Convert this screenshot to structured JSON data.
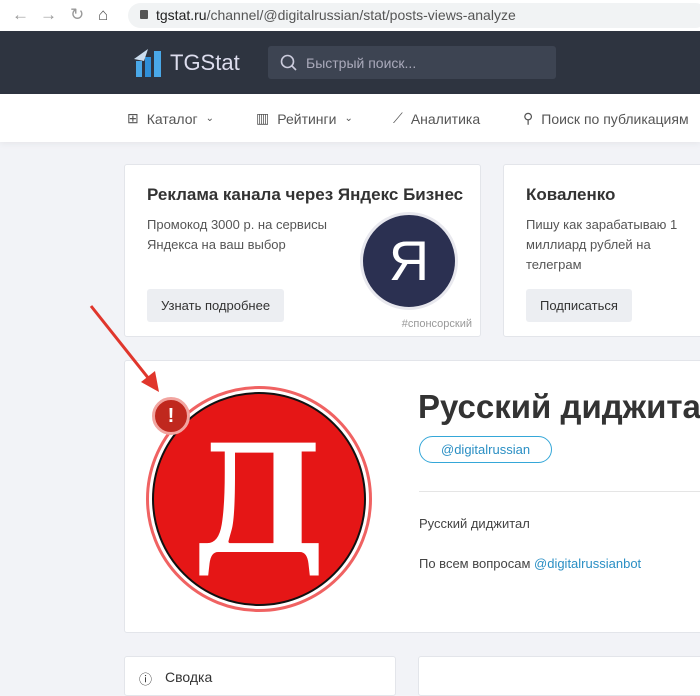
{
  "browser": {
    "url_domain": "tgstat.ru",
    "url_path": "/channel/@digitalrussian/stat/posts-views-analyze"
  },
  "header": {
    "logo": "TGStat",
    "search_placeholder": "Быстрый поиск..."
  },
  "nav": [
    {
      "label": "Каталог"
    },
    {
      "label": "Рейтинги"
    },
    {
      "label": "Аналитика"
    },
    {
      "label": "Поиск по публикациям"
    }
  ],
  "ads": [
    {
      "title": "Реклама канала через Яндекс Бизнес",
      "desc": "Промокод 3000 р. на сервисы Яндекса на ваш выбор",
      "button": "Узнать подробнее",
      "logo_letter": "Я",
      "sponsored": "#спонсорский"
    },
    {
      "title": "Коваленко",
      "desc": "Пишу как зарабатываю 1 миллиард рублей на телеграм",
      "button": "Подписаться"
    }
  ],
  "channel": {
    "title": "Русский диджитал",
    "handle": "@digitalrussian",
    "description": "Русский диджитал",
    "contact_prefix": "По всем вопросам",
    "contact_link": "@digitalrussianbot",
    "avatar_letter": "Д",
    "warning": "!"
  },
  "summary": {
    "label": "Сводка"
  },
  "colors": {
    "accent": "#35a7d8",
    "topbar": "#2e3440",
    "avatar": "#e51616",
    "arrow": "#e0362c"
  }
}
